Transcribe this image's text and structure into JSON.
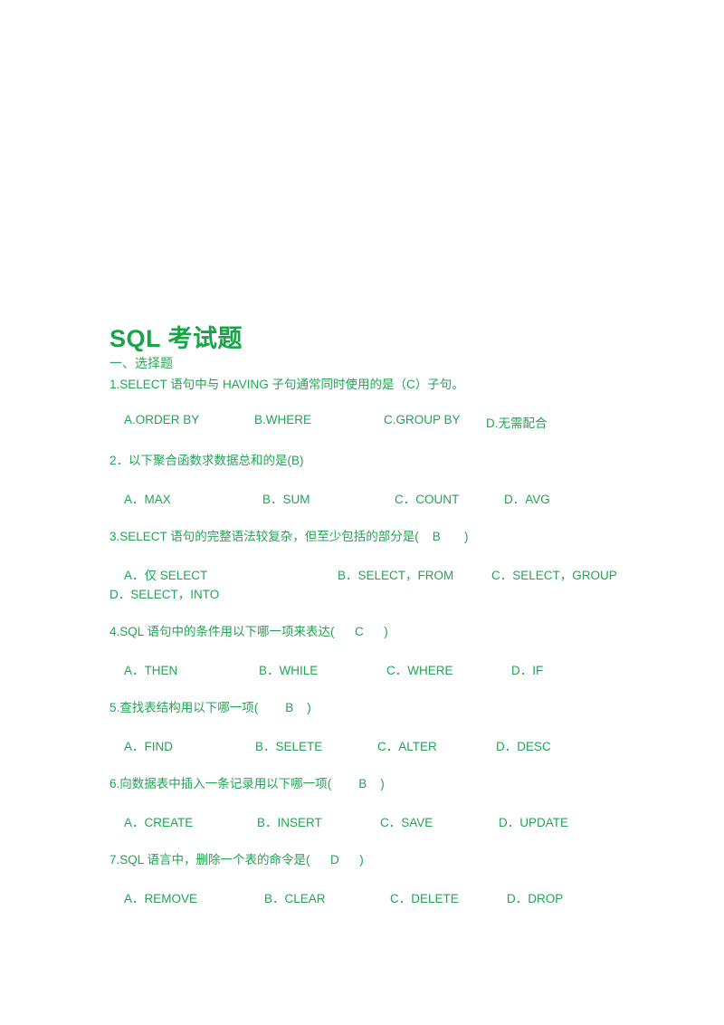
{
  "document": {
    "title": "SQL 考试题",
    "section": "一、选择题",
    "colors": {
      "title": "#19a44a",
      "text": "#23a455"
    },
    "questions": [
      {
        "text": "1.SELECT 语句中与 HAVING 子句通常同时使用的是（C）子句。",
        "options": [
          "A.ORDER BY",
          "B.WHERE",
          "C.GROUP BY",
          "D.无需配合"
        ]
      },
      {
        "text": "2．以下聚合函数求数据总和的是(B)",
        "options": [
          "A．MAX",
          "B．SUM",
          "C．COUNT",
          "D．AVG"
        ]
      },
      {
        "text": "3.SELECT 语句的完整语法较复杂，但至少包括的部分是(    B       )",
        "options": [
          "A．仅 SELECT",
          "B．SELECT，FROM",
          "C．SELECT，GROUP",
          "D．SELECT，INTO"
        ]
      },
      {
        "text": "4.SQL 语句中的条件用以下哪一项来表达(      C      )",
        "options": [
          "A．THEN",
          "B．WHILE",
          "C．WHERE",
          "D．IF"
        ]
      },
      {
        "text": "5.查找表结构用以下哪一项(        B    )",
        "options": [
          "A．FIND",
          "B．SELETE",
          "C．ALTER",
          "D．DESC"
        ]
      },
      {
        "text": "6.向数据表中插入一条记录用以下哪一项(        B    )",
        "options": [
          "A．CREATE",
          "B．INSERT",
          "C．SAVE",
          "D．UPDATE"
        ]
      },
      {
        "text": "7.SQL 语言中，删除一个表的命令是(      D      )",
        "options": [
          "A．REMOVE",
          "B．CLEAR",
          "C．DELETE",
          "D．DROP"
        ]
      }
    ]
  }
}
